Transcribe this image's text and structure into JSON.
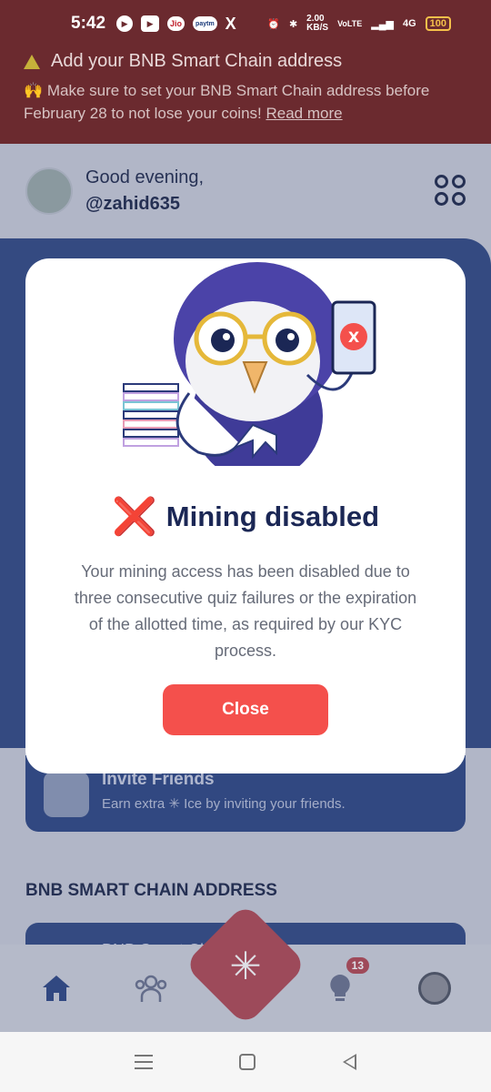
{
  "status_bar": {
    "time": "5:42",
    "app_icons": [
      "play-icon",
      "youtube-icon",
      "jio-icon",
      "paytm-icon",
      "x-icon"
    ],
    "jio_label": "Jio",
    "paytm_label": "paytm",
    "x_label": "X",
    "speed": "2.00\nKB/S",
    "volte": "VoLTE",
    "network": "4G",
    "battery": "100"
  },
  "banner": {
    "title": "Add your BNB Smart Chain address",
    "text": "🙌 Make sure to set your BNB Smart Chain address before February 28 to not lose your coins!",
    "link": "Read more"
  },
  "home": {
    "greeting": "Good evening,",
    "username": "@zahid635"
  },
  "invite": {
    "title": "Invite Friends",
    "subtitle": "Earn extra ✳ Ice by inviting your friends."
  },
  "chain_section": {
    "label": "BNB SMART CHAIN ADDRESS",
    "card_text": "BNB Smart Chain address"
  },
  "bottom_nav": {
    "notifications_badge": "13"
  },
  "modal": {
    "title_icon": "❌",
    "title": "Mining disabled",
    "body": "Your mining access has been disabled due to three consecutive quiz failures or the expiration of the allotted time, as required by our KYC process.",
    "close_label": "Close"
  },
  "colors": {
    "banner_bg": "#6b2a2f",
    "title_navy": "#1b2755",
    "close_button": "#f4504c",
    "app_blue": "#304a86"
  }
}
